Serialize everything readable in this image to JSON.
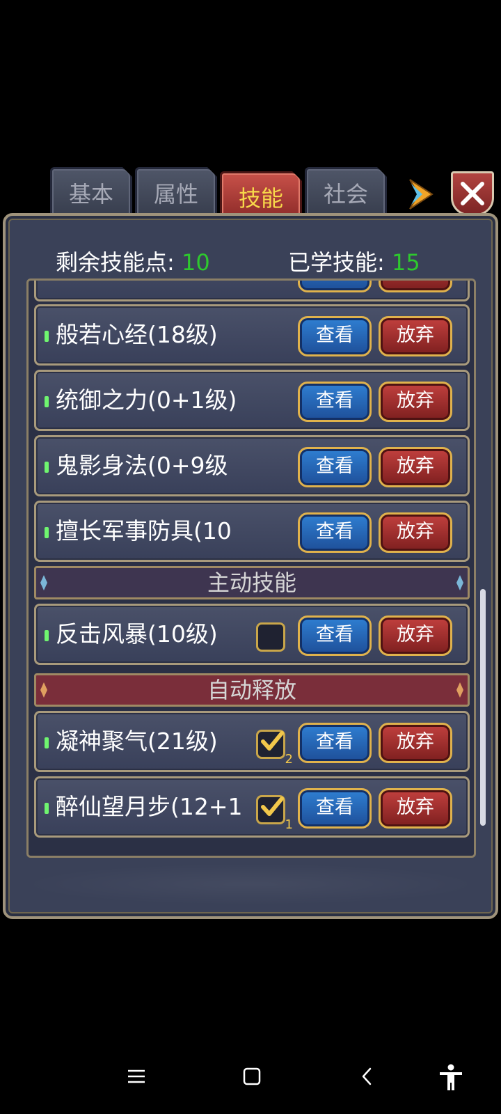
{
  "tabs": [
    {
      "label": "基本",
      "active": false
    },
    {
      "label": "属性",
      "active": false
    },
    {
      "label": "技能",
      "active": true
    },
    {
      "label": "社会",
      "active": false
    }
  ],
  "stats": {
    "remaining_label": "剩余技能点:",
    "remaining_value": "10",
    "learned_label": "已学技能:",
    "learned_value": "15"
  },
  "buttons": {
    "view": "查看",
    "drop": "放弃"
  },
  "passive_skills": [
    {
      "name": "般若心经(18级)"
    },
    {
      "name": "统御之力(0+1级)"
    },
    {
      "name": "鬼影身法(0+9级"
    },
    {
      "name": "擅长军事防具(10"
    }
  ],
  "sections": {
    "active": "主动技能",
    "auto": "自动释放"
  },
  "active_skills": [
    {
      "name": "反击风暴(10级)",
      "checked": false
    }
  ],
  "auto_skills": [
    {
      "name": "凝神聚气(21级)",
      "checked": true,
      "order": "2"
    },
    {
      "name": "醉仙望月步(12+1",
      "checked": true,
      "order": "1"
    }
  ],
  "colors": {
    "panel": "#3a4158",
    "accent_green": "#2ec82e",
    "active_tab": "#c85149",
    "view_button": "#2f7fd2",
    "drop_button": "#c2403e"
  },
  "icons": [
    "next-arrow-icon",
    "close-icon",
    "checkmark-icon",
    "menu-icon",
    "home-icon",
    "back-icon",
    "accessibility-icon"
  ]
}
